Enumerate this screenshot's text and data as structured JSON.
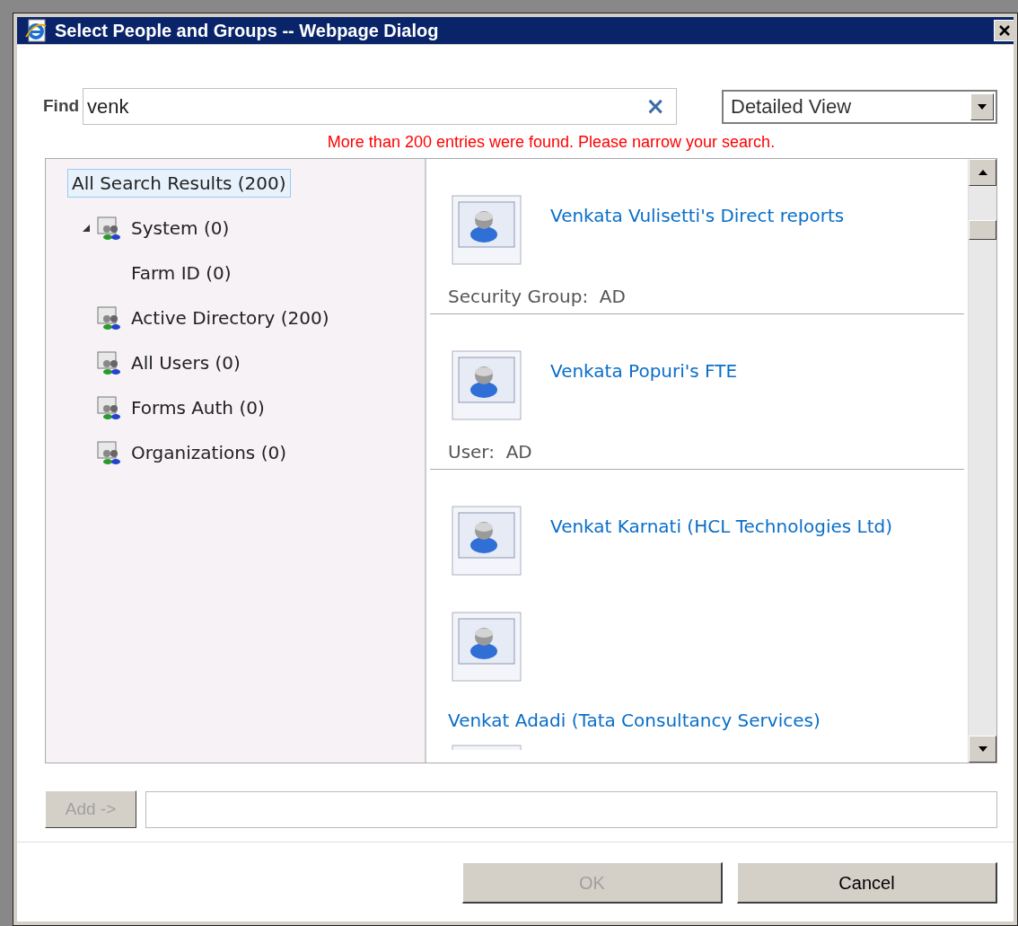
{
  "window": {
    "title": "Select People and Groups -- Webpage Dialog"
  },
  "find": {
    "label": "Find",
    "value": "venk",
    "clear": "×"
  },
  "view_select": {
    "value": "Detailed View"
  },
  "message": "More than 200 entries were found. Please narrow your search.",
  "tree": [
    {
      "label": "All Search Results (200)",
      "selected": true,
      "kind": "root"
    },
    {
      "label": "System (0)",
      "selected": false,
      "kind": "group",
      "expanded": true,
      "children": [
        {
          "label": "Farm ID (0)",
          "selected": false,
          "kind": "leaf"
        }
      ]
    },
    {
      "label": "Active Directory (200)",
      "selected": false,
      "kind": "group"
    },
    {
      "label": "All Users (0)",
      "selected": false,
      "kind": "group"
    },
    {
      "label": "Forms Auth (0)",
      "selected": false,
      "kind": "group"
    },
    {
      "label": "Organizations (0)",
      "selected": false,
      "kind": "group"
    }
  ],
  "results": [
    {
      "kind": "person",
      "name": "Venkata Vulisetti's Direct reports"
    },
    {
      "kind": "header",
      "text": "Security Group:  AD"
    },
    {
      "kind": "person",
      "name": "Venkata Popuri's FTE"
    },
    {
      "kind": "header",
      "text": "User:  AD"
    },
    {
      "kind": "person",
      "name": "Venkat Karnati (HCL Technologies Ltd)"
    },
    {
      "kind": "stacked",
      "name": "Venkat Adadi (Tata Consultancy Services)"
    },
    {
      "kind": "partial"
    }
  ],
  "add_button": {
    "label": "Add ->",
    "disabled": true
  },
  "buttons": [
    {
      "label": "OK",
      "disabled": true
    },
    {
      "label": "Cancel",
      "disabled": false
    }
  ]
}
